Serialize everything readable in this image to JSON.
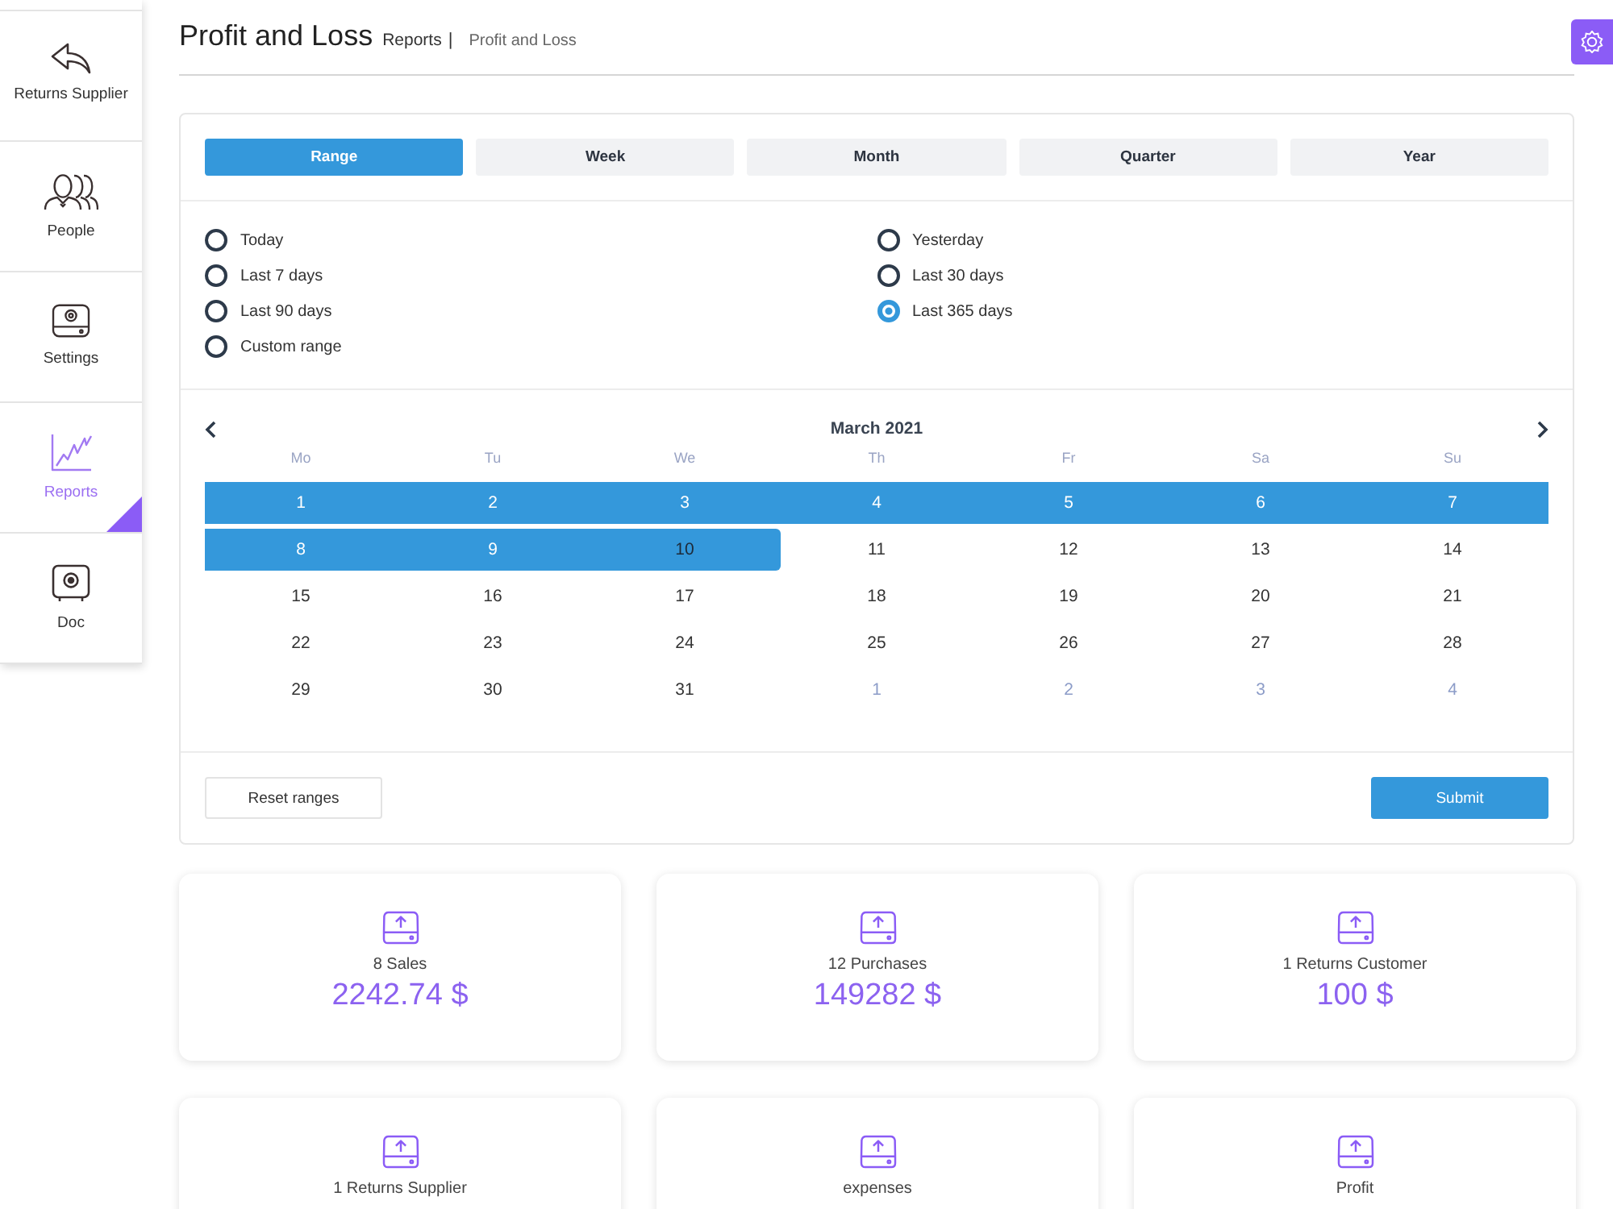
{
  "sidebar": {
    "items": [
      {
        "label": "Returns Supplier",
        "kind": "returns",
        "selected": false
      },
      {
        "label": "People",
        "kind": "people",
        "selected": false
      },
      {
        "label": "Settings",
        "kind": "settings",
        "selected": false
      },
      {
        "label": "Reports",
        "kind": "reports",
        "selected": true
      },
      {
        "label": "Doc",
        "kind": "doc",
        "selected": false
      }
    ]
  },
  "header": {
    "title": "Profit and Loss",
    "breadcrumb": [
      {
        "label": "Reports"
      },
      {
        "label": "Profit and Loss"
      }
    ],
    "separator": "|"
  },
  "range_picker": {
    "tabs": [
      {
        "label": "Range",
        "selected": true
      },
      {
        "label": "Week",
        "selected": false
      },
      {
        "label": "Month",
        "selected": false
      },
      {
        "label": "Quarter",
        "selected": false
      },
      {
        "label": "Year",
        "selected": false
      }
    ],
    "range_columns": [
      {
        "options": [
          {
            "label": "Today",
            "selected": false
          },
          {
            "label": "Last 7 days",
            "selected": false
          },
          {
            "label": "Last 90 days",
            "selected": false
          },
          {
            "label": "Custom range",
            "selected": false
          }
        ]
      },
      {
        "options": [
          {
            "label": "Yesterday",
            "selected": false
          },
          {
            "label": "Last 30 days",
            "selected": false
          },
          {
            "label": "Last 365 days",
            "selected": true
          }
        ]
      }
    ],
    "calendar": {
      "month": "March 2021",
      "weekdays": [
        "Mo",
        "Tu",
        "We",
        "Th",
        "Fr",
        "Sa",
        "Su"
      ],
      "weeks": [
        [
          {
            "day": "1",
            "in_range": true,
            "range_end": false,
            "other_month": false
          },
          {
            "day": "2",
            "in_range": true,
            "range_end": false,
            "other_month": false
          },
          {
            "day": "3",
            "in_range": true,
            "range_end": false,
            "other_month": false
          },
          {
            "day": "4",
            "in_range": true,
            "range_end": false,
            "other_month": false
          },
          {
            "day": "5",
            "in_range": true,
            "range_end": false,
            "other_month": false
          },
          {
            "day": "6",
            "in_range": true,
            "range_end": false,
            "other_month": false
          },
          {
            "day": "7",
            "in_range": true,
            "range_end": false,
            "other_month": false
          }
        ],
        [
          {
            "day": "8",
            "in_range": true,
            "range_end": false,
            "other_month": false
          },
          {
            "day": "9",
            "in_range": true,
            "range_end": false,
            "other_month": false
          },
          {
            "day": "10",
            "in_range": true,
            "range_end": true,
            "other_month": false
          },
          {
            "day": "11",
            "in_range": false,
            "range_end": false,
            "other_month": false
          },
          {
            "day": "12",
            "in_range": false,
            "range_end": false,
            "other_month": false
          },
          {
            "day": "13",
            "in_range": false,
            "range_end": false,
            "other_month": false
          },
          {
            "day": "14",
            "in_range": false,
            "range_end": false,
            "other_month": false
          }
        ],
        [
          {
            "day": "15",
            "in_range": false,
            "range_end": false,
            "other_month": false
          },
          {
            "day": "16",
            "in_range": false,
            "range_end": false,
            "other_month": false
          },
          {
            "day": "17",
            "in_range": false,
            "range_end": false,
            "other_month": false
          },
          {
            "day": "18",
            "in_range": false,
            "range_end": false,
            "other_month": false
          },
          {
            "day": "19",
            "in_range": false,
            "range_end": false,
            "other_month": false
          },
          {
            "day": "20",
            "in_range": false,
            "range_end": false,
            "other_month": false
          },
          {
            "day": "21",
            "in_range": false,
            "range_end": false,
            "other_month": false
          }
        ],
        [
          {
            "day": "22",
            "in_range": false,
            "range_end": false,
            "other_month": false
          },
          {
            "day": "23",
            "in_range": false,
            "range_end": false,
            "other_month": false
          },
          {
            "day": "24",
            "in_range": false,
            "range_end": false,
            "other_month": false
          },
          {
            "day": "25",
            "in_range": false,
            "range_end": false,
            "other_month": false
          },
          {
            "day": "26",
            "in_range": false,
            "range_end": false,
            "other_month": false
          },
          {
            "day": "27",
            "in_range": false,
            "range_end": false,
            "other_month": false
          },
          {
            "day": "28",
            "in_range": false,
            "range_end": false,
            "other_month": false
          }
        ],
        [
          {
            "day": "29",
            "in_range": false,
            "range_end": false,
            "other_month": false
          },
          {
            "day": "30",
            "in_range": false,
            "range_end": false,
            "other_month": false
          },
          {
            "day": "31",
            "in_range": false,
            "range_end": false,
            "other_month": false
          },
          {
            "day": "1",
            "in_range": false,
            "range_end": false,
            "other_month": true
          },
          {
            "day": "2",
            "in_range": false,
            "range_end": false,
            "other_month": true
          },
          {
            "day": "3",
            "in_range": false,
            "range_end": false,
            "other_month": true
          },
          {
            "day": "4",
            "in_range": false,
            "range_end": false,
            "other_month": true
          }
        ]
      ]
    },
    "buttons": [
      {
        "label": "Reset ranges",
        "kind": "secondary"
      },
      {
        "label": "Submit",
        "kind": "primary"
      }
    ]
  },
  "stats": [
    {
      "label": "8 Sales",
      "value": "2242.74 $"
    },
    {
      "label": "12 Purchases",
      "value": "149282 $"
    },
    {
      "label": "1 Returns Customer",
      "value": "100 $"
    },
    {
      "label": "1 Returns Supplier"
    },
    {
      "label": "expenses"
    },
    {
      "label": "Profit"
    }
  ]
}
